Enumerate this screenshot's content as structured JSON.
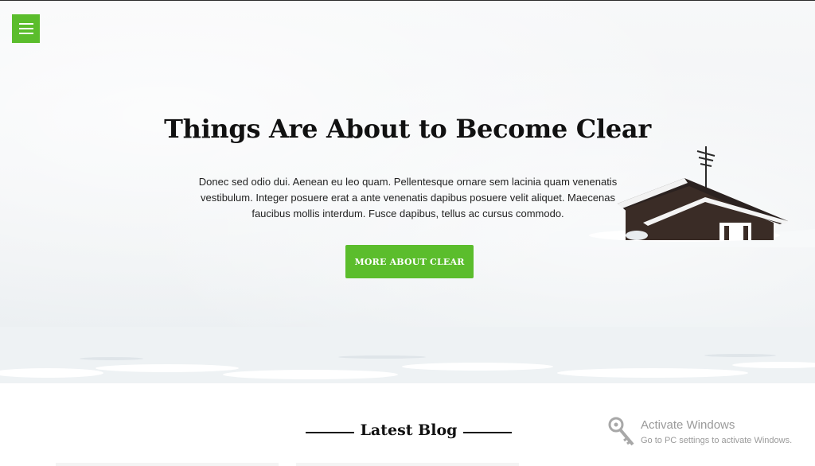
{
  "nav": {
    "menu_icon": "hamburger-menu-icon"
  },
  "hero": {
    "title": "Things Are About to Become Clear",
    "text": "Donec sed odio dui. Aenean eu leo quam. Pellentesque ornare sem lacinia quam venenatis vestibulum. Integer posuere erat a ante venenatis dapibus posuere velit aliquet. Maecenas faucibus mollis interdum. Fusce dapibus, tellus ac cursus commodo.",
    "button_label": "MORE ABOUT CLEAR",
    "image": "snowy-cabin-landscape"
  },
  "blog": {
    "title": "Latest Blog"
  },
  "os_watermark": {
    "title": "Activate Windows",
    "subtitle": "Go to PC settings to activate Windows.",
    "icon": "key-icon"
  },
  "colors": {
    "accent": "#5bbd2c",
    "text": "#111111"
  }
}
